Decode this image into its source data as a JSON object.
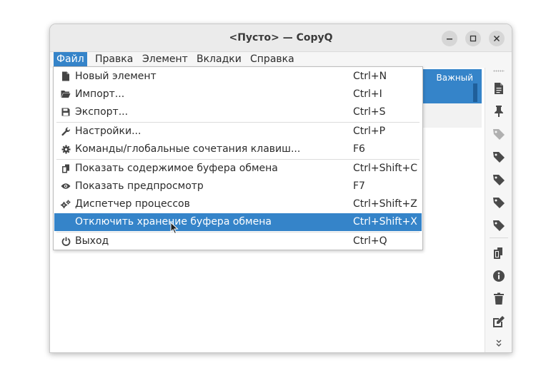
{
  "window": {
    "title": "<Пусто> — CopyQ"
  },
  "menubar": {
    "items": [
      {
        "label": "Файл"
      },
      {
        "label": "Правка"
      },
      {
        "label": "Элемент"
      },
      {
        "label": "Вкладки"
      },
      {
        "label": "Справка"
      }
    ],
    "active_index": 0
  },
  "item_list": {
    "selected_item_tag": "Важный"
  },
  "file_menu": {
    "items": [
      {
        "icon": "new-file-icon",
        "label": "Новый элемент",
        "shortcut": "Ctrl+N"
      },
      {
        "icon": "folder-open-icon",
        "label": "Импорт...",
        "shortcut": "Ctrl+I"
      },
      {
        "icon": "save-icon",
        "label": "Экспорт...",
        "shortcut": "Ctrl+S"
      },
      {
        "icon": "wrench-icon",
        "label": "Настройки...",
        "shortcut": "Ctrl+P"
      },
      {
        "icon": "gear-icon",
        "label": "Команды/глобальные сочетания клавиш...",
        "shortcut": "F6"
      },
      {
        "icon": "clipboard-copy-icon",
        "label": "Показать содержимое буфера обмена",
        "shortcut": "Ctrl+Shift+C"
      },
      {
        "icon": "eye-icon",
        "label": "Показать предпросмотр",
        "shortcut": "F7"
      },
      {
        "icon": "gears-icon",
        "label": "Диспетчер процессов",
        "shortcut": "Ctrl+Shift+Z"
      },
      {
        "icon": "none",
        "label": "Отключить хранение буфера обмена",
        "shortcut": "Ctrl+Shift+X"
      },
      {
        "icon": "power-icon",
        "label": "Выход",
        "shortcut": "Ctrl+Q"
      }
    ],
    "highlighted_index": 8
  },
  "toolbar": {
    "icons": [
      "new-file-icon",
      "pin-icon",
      "tag-icon",
      "tag-icon",
      "tag-icon",
      "tag-icon",
      "tag-icon",
      "copy-icon",
      "info-icon",
      "trash-icon",
      "edit-icon",
      "more-chevron-icon"
    ]
  },
  "colors": {
    "accent": "#3584c9",
    "titlebar": "#ebebeb",
    "toolbar_icon": "#4a4a4a"
  }
}
